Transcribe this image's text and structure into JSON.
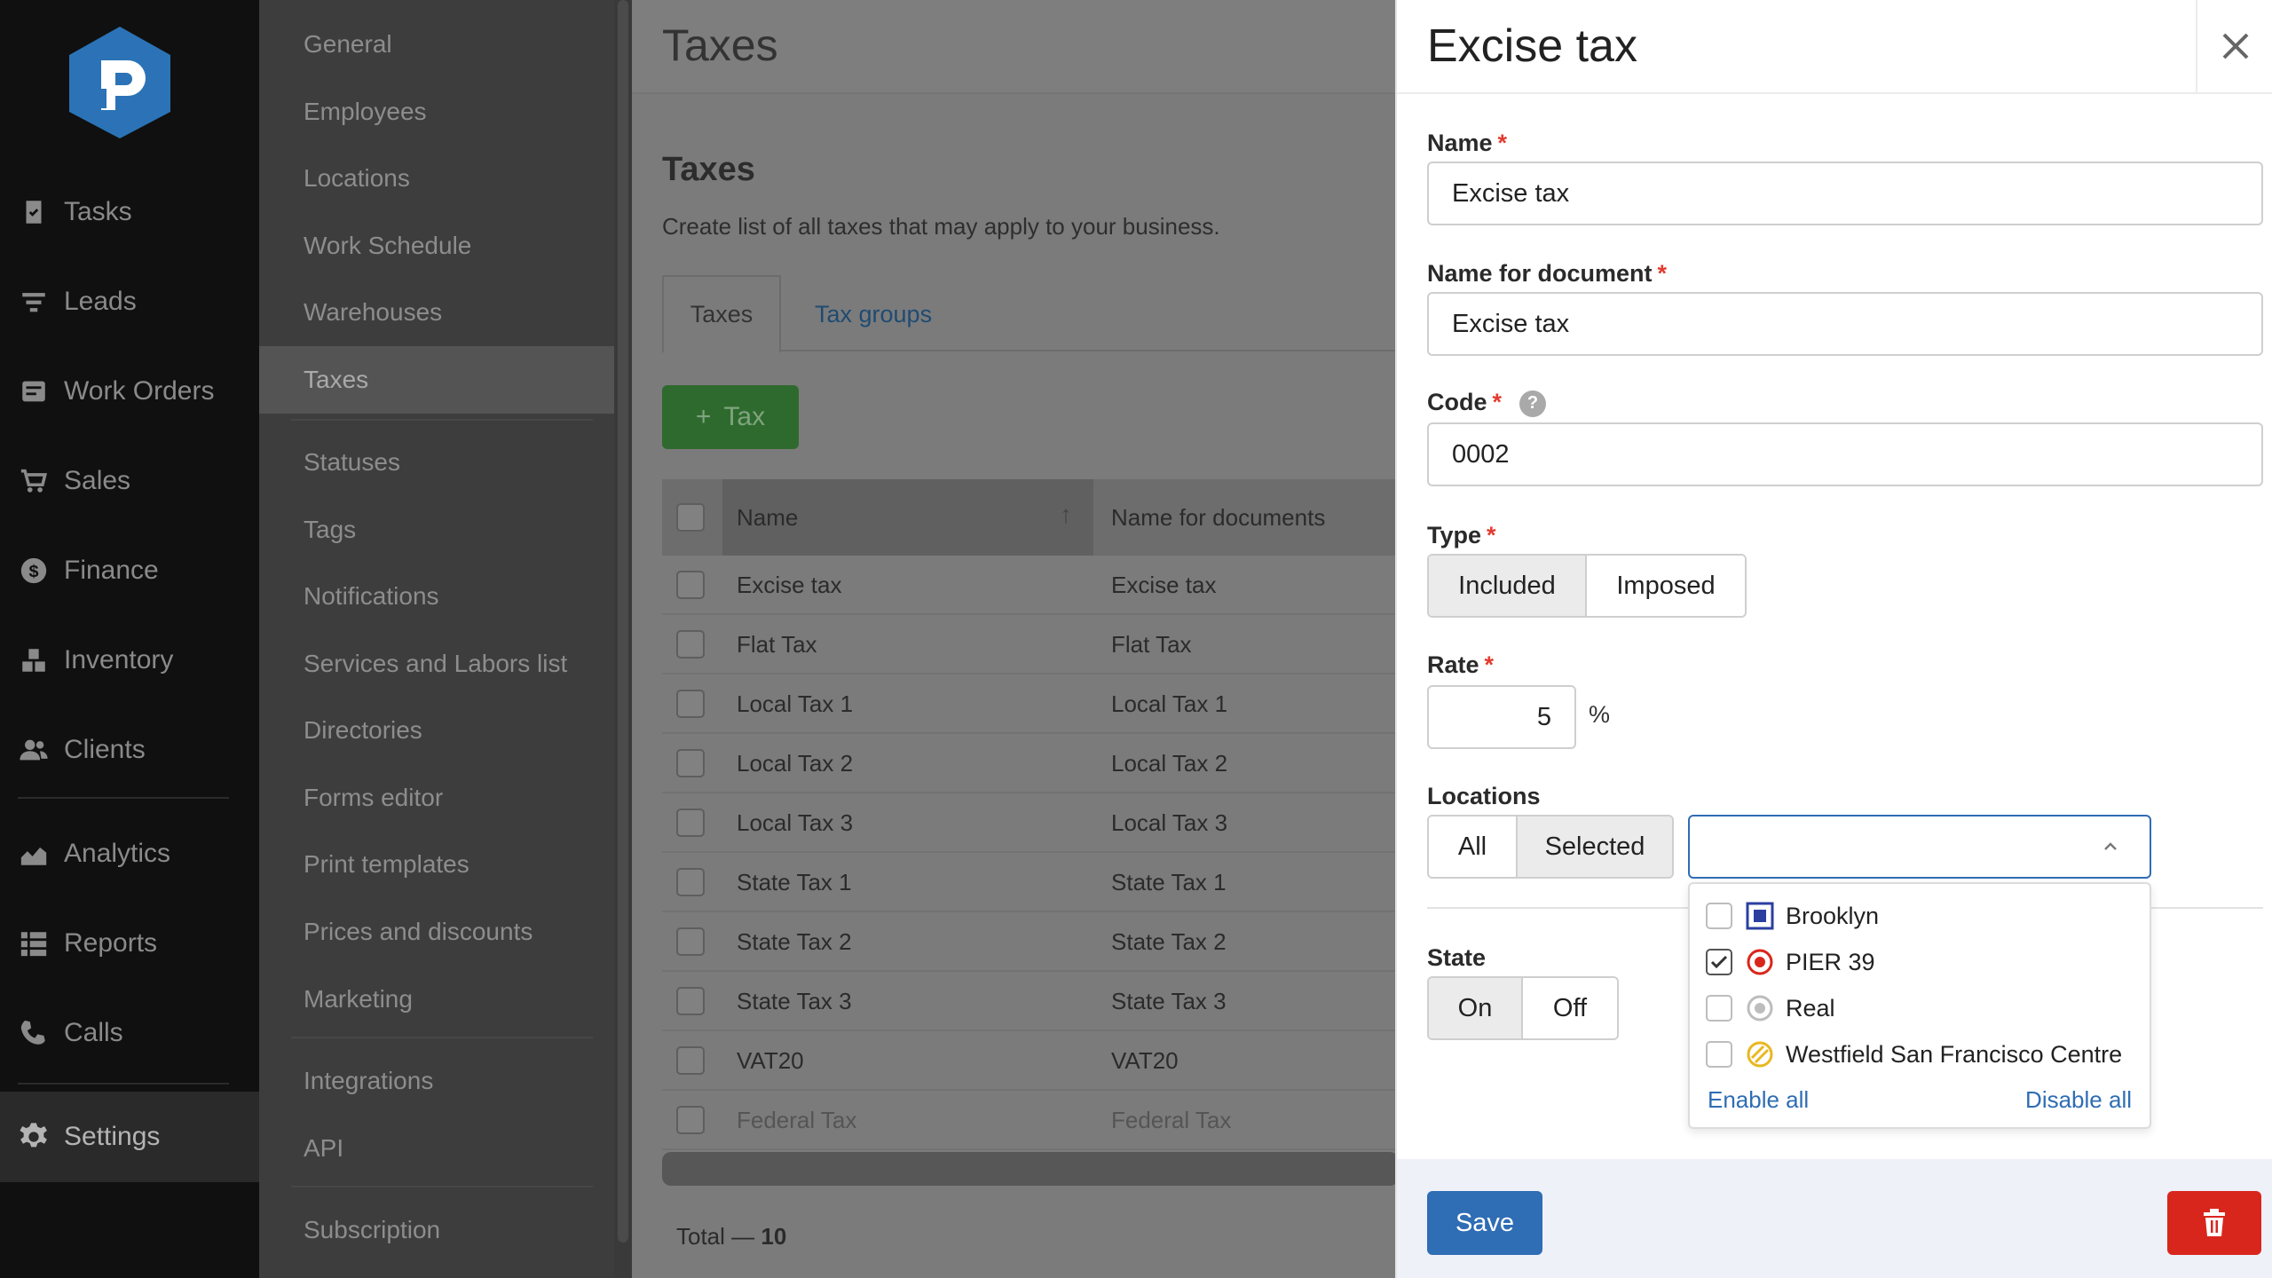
{
  "nav": {
    "items": [
      {
        "label": "Tasks",
        "icon": "tasks-icon"
      },
      {
        "label": "Leads",
        "icon": "filter-icon"
      },
      {
        "label": "Work Orders",
        "icon": "work-orders-icon"
      },
      {
        "label": "Sales",
        "icon": "cart-icon"
      },
      {
        "label": "Finance",
        "icon": "dollar-icon"
      },
      {
        "label": "Inventory",
        "icon": "boxes-icon"
      },
      {
        "label": "Clients",
        "icon": "users-icon"
      },
      {
        "label": "Analytics",
        "icon": "chart-icon"
      },
      {
        "label": "Reports",
        "icon": "list-icon"
      },
      {
        "label": "Calls",
        "icon": "phone-icon"
      },
      {
        "label": "Settings",
        "icon": "gear-icon"
      }
    ],
    "active": "Settings"
  },
  "submenu": {
    "items": [
      "General",
      "Employees",
      "Locations",
      "Work Schedule",
      "Warehouses",
      "Taxes",
      "Statuses",
      "Tags",
      "Notifications",
      "Services and Labors list",
      "Directories",
      "Forms editor",
      "Print templates",
      "Prices and discounts",
      "Marketing",
      "Integrations",
      "API",
      "Subscription"
    ],
    "active": "Taxes"
  },
  "main": {
    "page_title": "Taxes",
    "section_title": "Taxes",
    "description": "Create list of all taxes that may apply to your business.",
    "tabs": [
      "Taxes",
      "Tax groups"
    ],
    "add_button": "Tax",
    "columns": [
      "Name",
      "Name for documents"
    ],
    "rows": [
      [
        "Excise tax",
        "Excise tax"
      ],
      [
        "Flat Tax",
        "Flat Tax"
      ],
      [
        "Local Tax 1",
        "Local Tax 1"
      ],
      [
        "Local Tax 2",
        "Local Tax 2"
      ],
      [
        "Local Tax 3",
        "Local Tax 3"
      ],
      [
        "State Tax 1",
        "State Tax 1"
      ],
      [
        "State Tax 2",
        "State Tax 2"
      ],
      [
        "State Tax 3",
        "State Tax 3"
      ],
      [
        "VAT20",
        "VAT20"
      ],
      [
        "Federal Tax",
        "Federal Tax"
      ]
    ],
    "total_label": "Total —",
    "total_value": "10"
  },
  "panel": {
    "title": "Excise tax",
    "name_label": "Name",
    "name_value": "Excise tax",
    "doc_name_label": "Name for document",
    "doc_name_value": "Excise tax",
    "code_label": "Code",
    "code_help": "?",
    "code_value": "0002",
    "type_label": "Type",
    "type_options": [
      "Included",
      "Imposed"
    ],
    "type_selected": "Included",
    "rate_label": "Rate",
    "rate_value": "5",
    "rate_unit": "%",
    "locations_label": "Locations",
    "locations_options": [
      "All",
      "Selected"
    ],
    "locations_selected": "Selected",
    "locations_list": [
      {
        "name": "Brooklyn",
        "checked": false,
        "icon": "square-blue-icon"
      },
      {
        "name": "PIER 39",
        "checked": true,
        "icon": "target-red-icon"
      },
      {
        "name": "Real",
        "checked": false,
        "icon": "target-gray-icon"
      },
      {
        "name": "Westfield San Francisco Centre",
        "checked": false,
        "icon": "slash-yellow-icon"
      }
    ],
    "enable_all": "Enable all",
    "disable_all": "Disable all",
    "state_label": "State",
    "state_options": [
      "On",
      "Off"
    ],
    "state_selected": "On",
    "save_label": "Save",
    "colors": {
      "primary": "#2f6db4",
      "danger": "#d9261c",
      "required": "#e33b2f"
    }
  }
}
